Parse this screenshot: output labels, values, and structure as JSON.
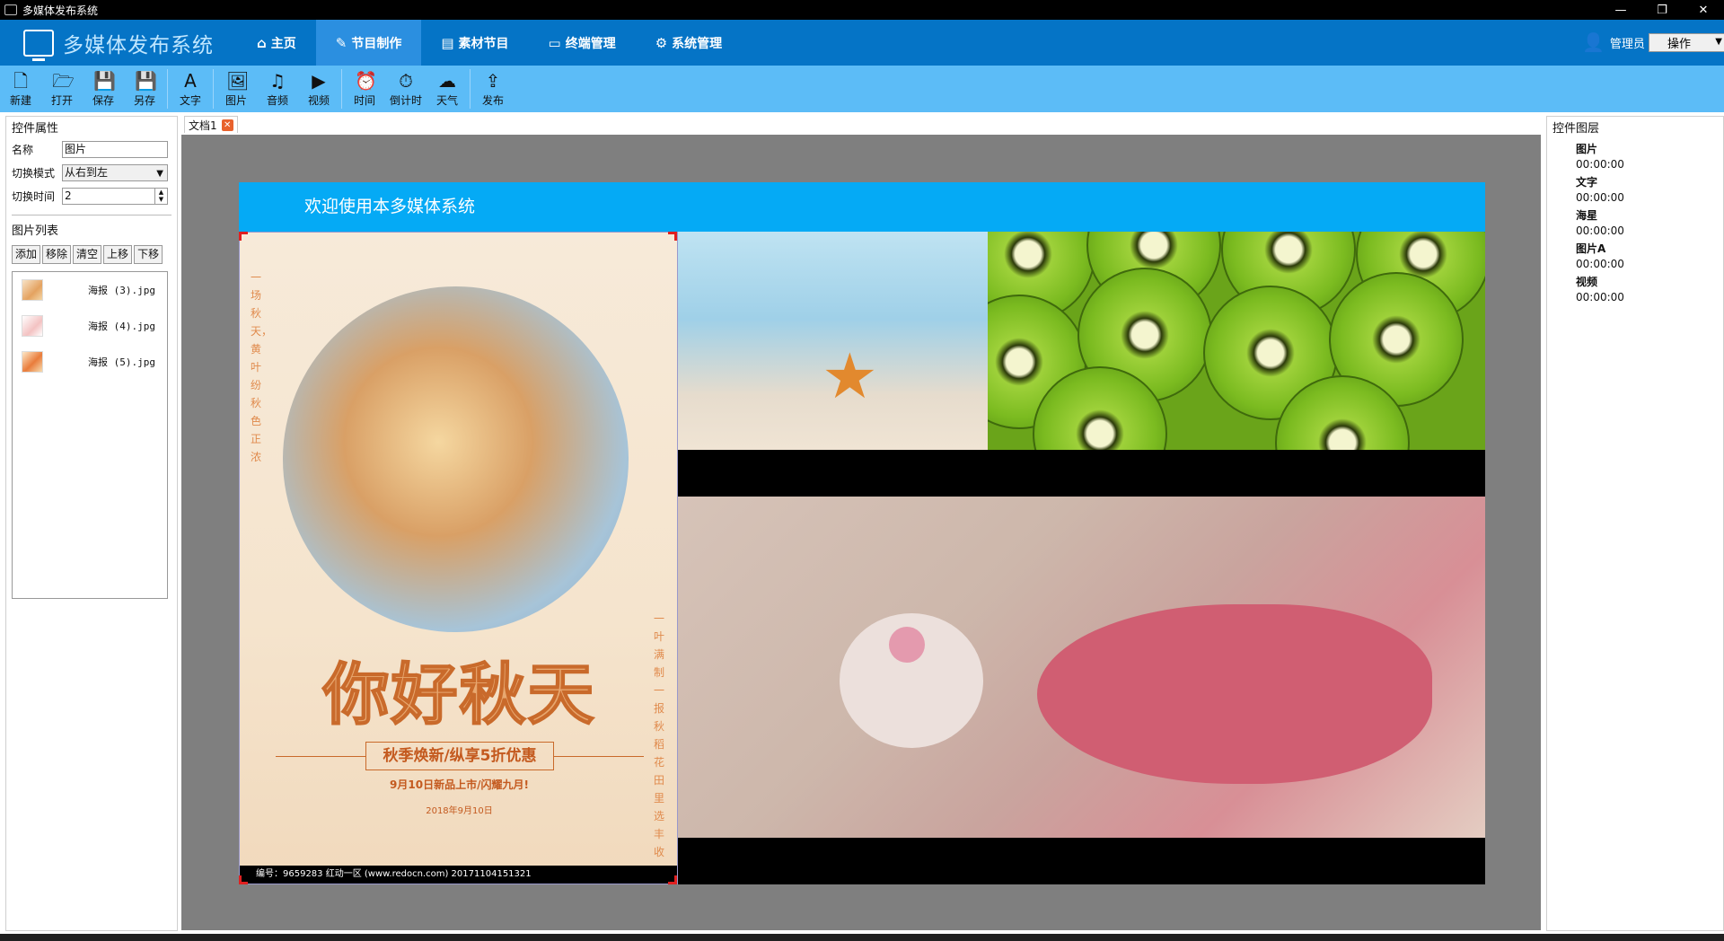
{
  "window": {
    "title": "多媒体发布系统",
    "controls": [
      "—",
      "❐",
      "✕"
    ]
  },
  "header": {
    "logo_text": "多媒体发布系统",
    "nav": [
      {
        "label": "主页",
        "icon": "home-icon",
        "glyph": "⌂"
      },
      {
        "label": "节目制作",
        "icon": "edit-icon",
        "glyph": "✎"
      },
      {
        "label": "素材节目",
        "icon": "document-icon",
        "glyph": "▤"
      },
      {
        "label": "终端管理",
        "icon": "monitor-icon",
        "glyph": "▭"
      },
      {
        "label": "系统管理",
        "icon": "gear-icon",
        "glyph": "⚙"
      }
    ],
    "active_nav": "节目制作",
    "user": "管理员",
    "operation": "操作"
  },
  "toolbar": [
    {
      "label": "新建",
      "glyph": "🗋"
    },
    {
      "label": "打开",
      "glyph": "🗁"
    },
    {
      "label": "保存",
      "glyph": "💾"
    },
    {
      "label": "另存",
      "glyph": "💾"
    },
    {
      "label": "文字",
      "glyph": "A"
    },
    {
      "label": "图片",
      "glyph": "🖼"
    },
    {
      "label": "音频",
      "glyph": "♫"
    },
    {
      "label": "视频",
      "glyph": "▶"
    },
    {
      "label": "时间",
      "glyph": "⏰"
    },
    {
      "label": "倒计时",
      "glyph": "⏱"
    },
    {
      "label": "天气",
      "glyph": "☁"
    },
    {
      "label": "发布",
      "glyph": "⇪"
    }
  ],
  "props": {
    "title": "控件属性",
    "name_label": "名称",
    "name_value": "图片",
    "mode_label": "切换模式",
    "mode_value": "从右到左",
    "time_label": "切换时间",
    "time_value": "2",
    "list_title": "图片列表",
    "buttons": [
      "添加",
      "移除",
      "清空",
      "上移",
      "下移"
    ],
    "images": [
      "海报 (3).jpg",
      "海报 (4).jpg",
      "海报 (5).jpg"
    ]
  },
  "document": {
    "tab": "文档1",
    "banner": "欢迎使用本多媒体系统",
    "poster": {
      "vertical_left": "一场秋天，黄叶纷秋色正浓",
      "vertical_right": "一叶满制一报秋稻花田里选丰收",
      "big_title": "你好秋天",
      "sub": "秋季焕新/纵享5折优惠",
      "date1": "9月10日新品上市/闪耀九月!",
      "date2": "2018年9月10日",
      "footer": "编号：9659283  红动一区 (www.redocn.com)  20171104151321"
    }
  },
  "layers": {
    "title": "控件图层",
    "items": [
      {
        "name": "图片",
        "time": "00:00:00"
      },
      {
        "name": "文字",
        "time": "00:00:00"
      },
      {
        "name": "海星",
        "time": "00:00:00"
      },
      {
        "name": "图片A",
        "time": "00:00:00"
      },
      {
        "name": "视频",
        "time": "00:00:00"
      }
    ]
  }
}
